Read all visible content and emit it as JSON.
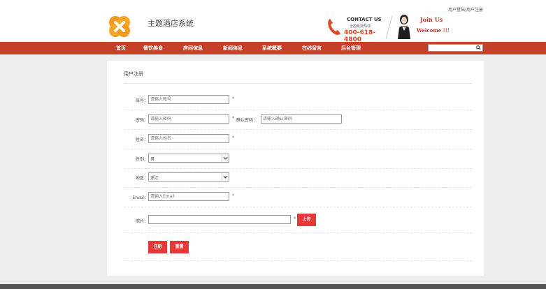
{
  "header": {
    "top_links": {
      "login": "用户登陆",
      "separator": "|",
      "register": "用户注册"
    },
    "site_title": "主题酒店系统",
    "contact": {
      "title": "CONTACT US",
      "subtitle": "全国免费热线:",
      "phone": "400-618-4800"
    },
    "join": {
      "title": "Join Us",
      "welcome": "Welcome !!!"
    }
  },
  "nav": {
    "items": [
      {
        "label": "首页"
      },
      {
        "label": "餐饮美食"
      },
      {
        "label": "房间信息"
      },
      {
        "label": "新闻信息"
      },
      {
        "label": "系统概要"
      },
      {
        "label": "在线留言"
      },
      {
        "label": "后台管理"
      }
    ],
    "search": {
      "placeholder": ""
    }
  },
  "form": {
    "title": "用户注册",
    "account": {
      "label": "账号：",
      "placeholder": "请输入账号",
      "required": "*"
    },
    "password": {
      "label": "密码：",
      "placeholder": "请输入密码",
      "required": "*"
    },
    "confirm_password": {
      "label": "确认密码：",
      "placeholder": "请输入确认密码"
    },
    "name": {
      "label": "姓名：",
      "placeholder": "请输入姓名",
      "required": "*"
    },
    "gender": {
      "label": "性别：",
      "value": "男"
    },
    "region": {
      "label": "地区：",
      "value": "浙江"
    },
    "email": {
      "label": "Email：",
      "placeholder": "请输入Email",
      "required": "*"
    },
    "photo": {
      "label": "照片：",
      "value": "",
      "required": "*",
      "upload_label": "上传"
    },
    "submit_label": "注册",
    "reset_label": "重置"
  },
  "colors": {
    "accent": "#c7402a",
    "button": "#e53838",
    "phone": "#e0492a",
    "join": "#c0392b"
  }
}
